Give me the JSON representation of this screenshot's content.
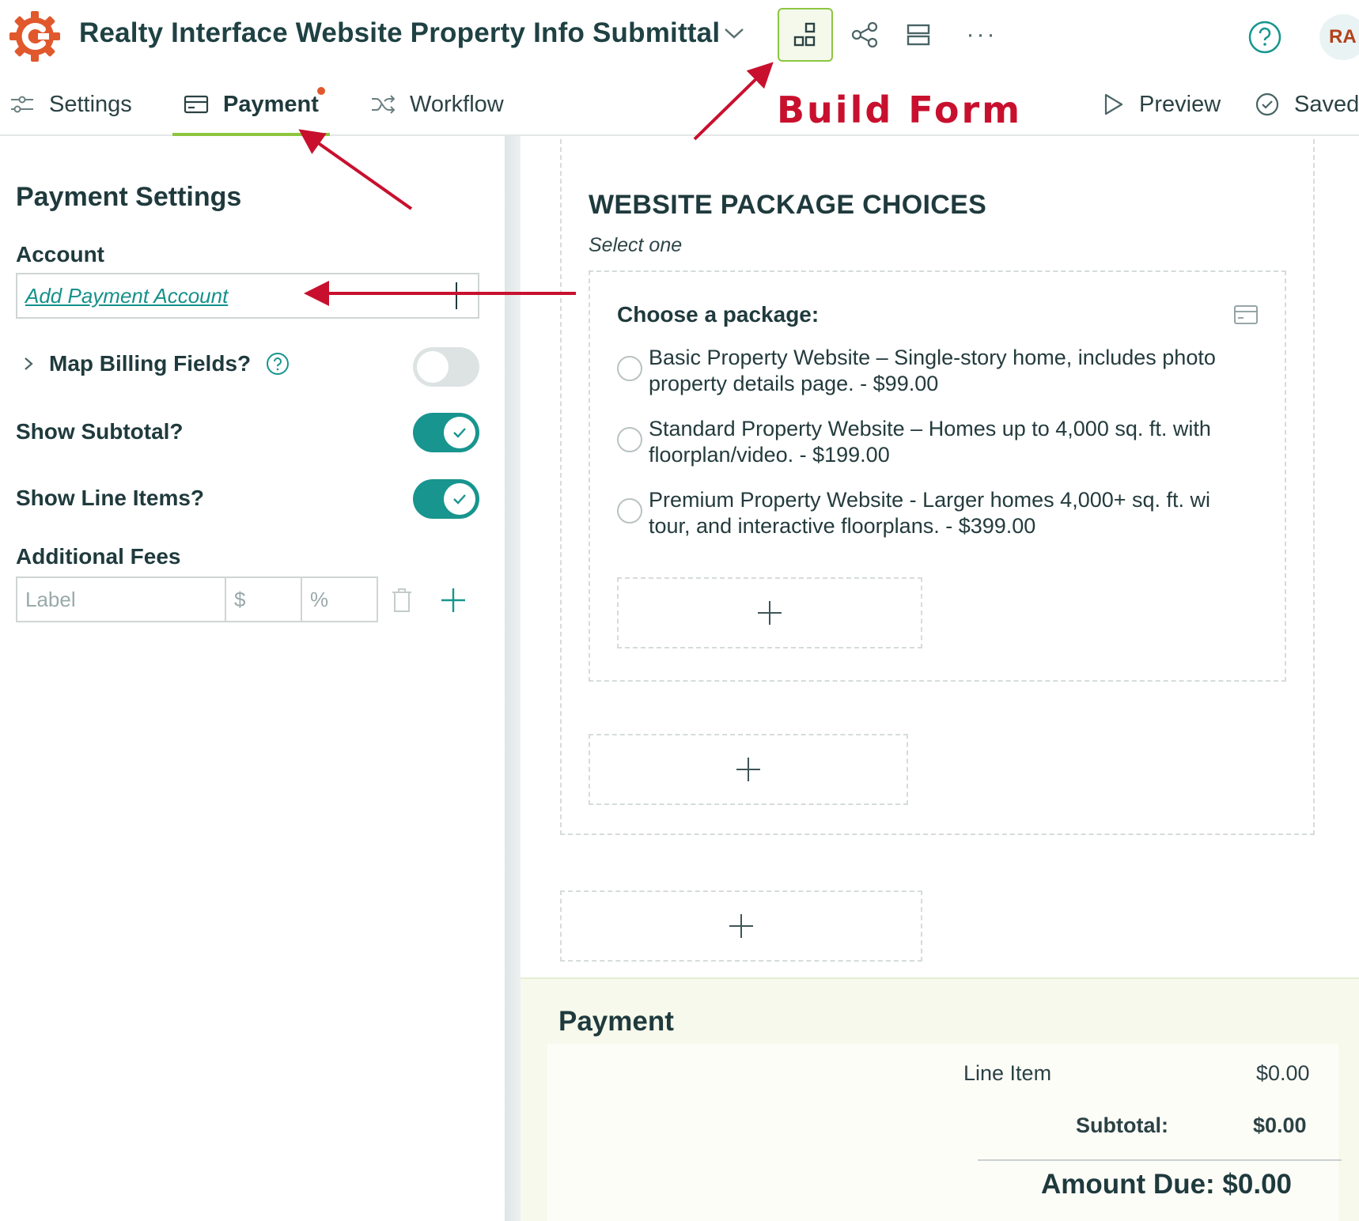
{
  "header": {
    "form_title": "Realty Interface Website Property Info Submittal",
    "avatar_initials": "RA",
    "more_label": "···",
    "brand_color": "#e0582c",
    "accent_color": "#8dc63f",
    "teal_color": "#17958e"
  },
  "tabs": [
    {
      "label": "Settings",
      "icon": "sliders-icon"
    },
    {
      "label": "Payment",
      "icon": "card-icon",
      "active": true,
      "has_notification": true
    },
    {
      "label": "Workflow",
      "icon": "shuffle-icon"
    }
  ],
  "actions": {
    "preview_label": "Preview",
    "saved_label": "Saved"
  },
  "annotation": {
    "build_form_label": "Build Form",
    "arrow_color": "#c8102e"
  },
  "payment_settings": {
    "heading": "Payment Settings",
    "account_label": "Account",
    "account_link": "Add Payment Account",
    "map_billing_label": "Map Billing Fields?",
    "map_billing_enabled": false,
    "show_subtotal_label": "Show Subtotal?",
    "show_subtotal_enabled": true,
    "show_line_items_label": "Show Line Items?",
    "show_line_items_enabled": true,
    "additional_fees_label": "Additional Fees",
    "fee_label_placeholder": "Label",
    "fee_amount_placeholder": "$",
    "fee_percent_placeholder": "%"
  },
  "form": {
    "section_title": "WEBSITE PACKAGE CHOICES",
    "section_subtitle": "Select one",
    "field_label": "Choose a package:",
    "options": [
      {
        "line1": "Basic Property Website – Single-story home, includes photo",
        "line2": "property details page. - $99.00"
      },
      {
        "line1": "Standard Property Website – Homes up to 4,000 sq. ft. with",
        "line2": "floorplan/video. - $199.00"
      },
      {
        "line1": "Premium Property Website - Larger homes 4,000+ sq. ft. wi",
        "line2": "tour, and interactive floorplans. - $399.00"
      }
    ]
  },
  "payment_summary": {
    "title": "Payment",
    "line_item_label": "Line Item",
    "line_item_value": "$0.00",
    "subtotal_label": "Subtotal:",
    "subtotal_value": "$0.00",
    "amount_due_label": "Amount Due: $0.00"
  }
}
